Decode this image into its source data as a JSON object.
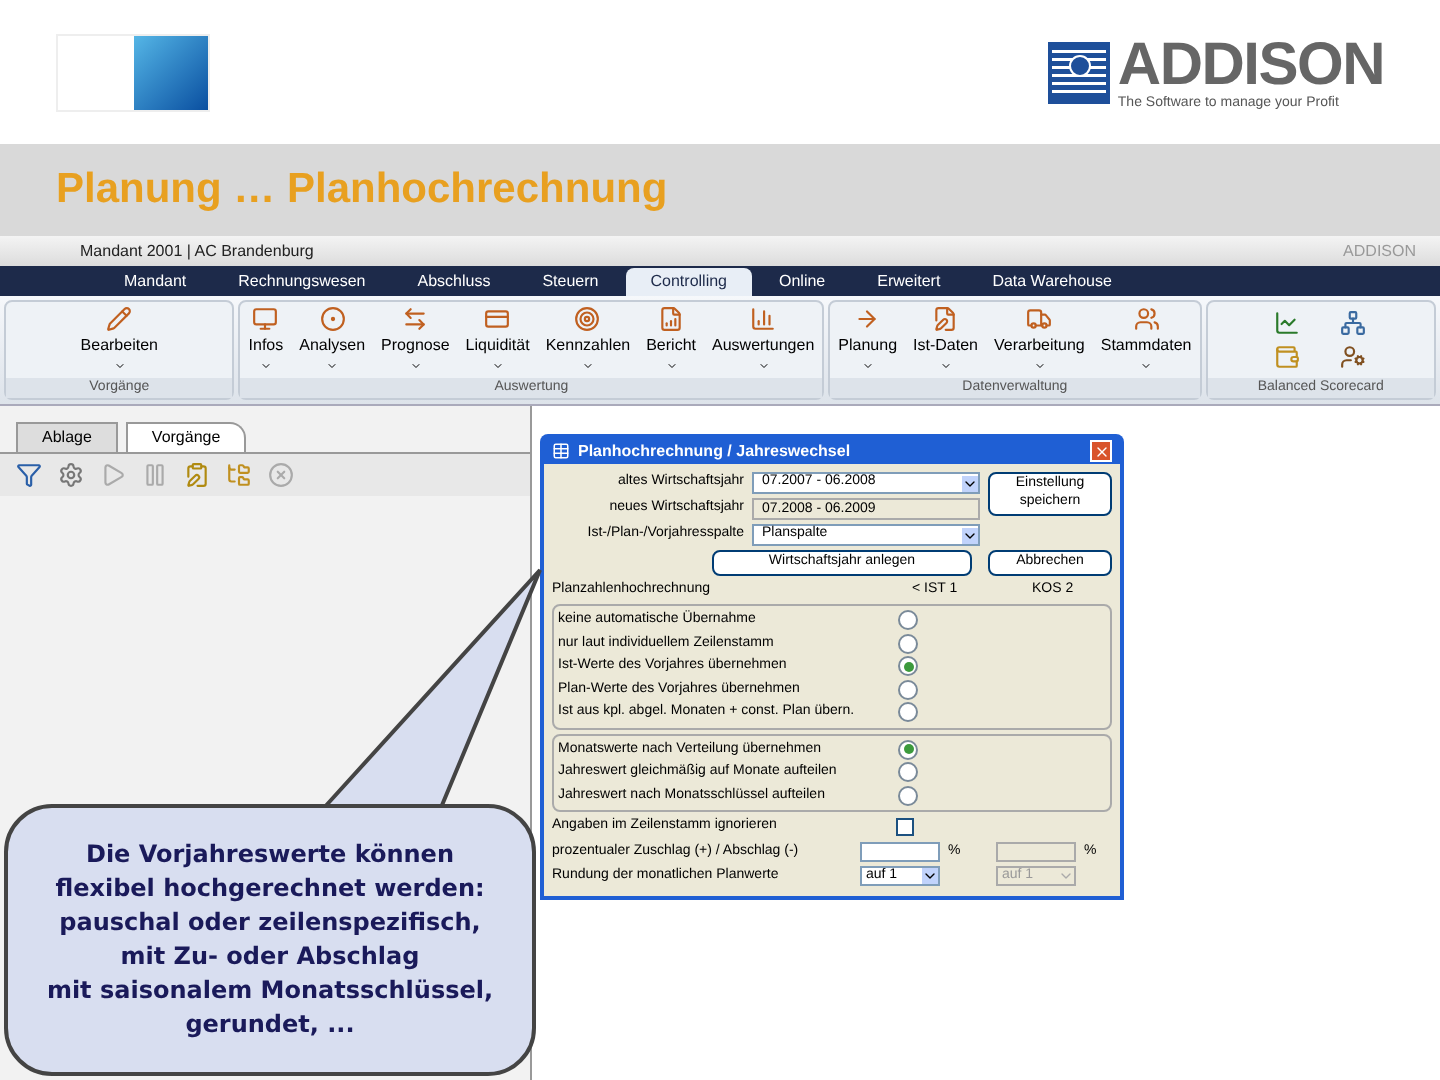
{
  "slide": {
    "title": "Planung … Planhochrechnung",
    "brand": "ADDISON",
    "tagline": "The Software to manage your Profit"
  },
  "app": {
    "title": "Mandant 2001 | AC Brandenburg",
    "brand": "ADDISON",
    "tabs": [
      {
        "label": "Mandant",
        "selected": false
      },
      {
        "label": "Rechnungswesen",
        "selected": false
      },
      {
        "label": "Abschluss",
        "selected": false
      },
      {
        "label": "Steuern",
        "selected": false
      },
      {
        "label": "Controlling",
        "selected": true
      },
      {
        "label": "Online",
        "selected": false
      },
      {
        "label": "Erweitert",
        "selected": false
      },
      {
        "label": "Data Warehouse",
        "selected": false
      }
    ],
    "ribbon_groups": [
      {
        "label": "Vorgänge",
        "items": [
          "Bearbeiten"
        ]
      },
      {
        "label": "Auswertung",
        "items": [
          "Infos",
          "Analysen",
          "Prognose",
          "Liquidität",
          "Kennzahlen",
          "Bericht",
          "Auswertungen"
        ]
      },
      {
        "label": "Datenverwaltung",
        "items": [
          "Planung",
          "Ist-Daten",
          "Verarbeitung",
          "Stammdaten"
        ]
      },
      {
        "label": "Balanced Scorecard"
      }
    ],
    "pane_tabs": [
      {
        "label": "Ablage",
        "selected": false
      },
      {
        "label": "Vorgänge",
        "selected": true
      }
    ]
  },
  "dialog": {
    "title": "Planhochrechnung / Jahreswechsel",
    "fields": [
      {
        "label": "altes Wirtschaftsjahr",
        "value": "07.2007 - 06.2008",
        "kind": "select"
      },
      {
        "label": "neues Wirtschaftsjahr",
        "value": "07.2008 - 06.2009",
        "kind": "text"
      },
      {
        "label": "Ist-/Plan-/Vorjahresspalte",
        "value": "Planspalte",
        "kind": "select"
      }
    ],
    "save_button": "Einstellung speichern",
    "create_button": "Wirtschaftsjahr anlegen",
    "cancel_button": "Abbrechen",
    "group_title": "Planzahlenhochrechnung",
    "column_1": "< IST 1",
    "column_2": "KOS 2",
    "options_1": [
      {
        "label": "keine automatische Übernahme",
        "selected": false
      },
      {
        "label": "nur laut individuellem Zeilenstamm",
        "selected": false
      },
      {
        "label": "Ist-Werte des Vorjahres übernehmen",
        "selected": true
      },
      {
        "label": "Plan-Werte des Vorjahres übernehmen",
        "selected": false
      },
      {
        "label": "Ist aus kpl. abgel. Monaten + const. Plan übern.",
        "selected": false
      }
    ],
    "options_2": [
      {
        "label": "Monatswerte nach Verteilung übernehmen",
        "selected": true
      },
      {
        "label": "Jahreswert gleichmäßig auf Monate aufteilen",
        "selected": false
      },
      {
        "label": "Jahreswert nach Monatsschlüssel aufteilen",
        "selected": false
      }
    ],
    "ignore": {
      "label": "Angaben im Zeilenstamm ignorieren",
      "checked": false
    },
    "percent": {
      "label": "prozentualer Zuschlag (+) / Abschlag (-)",
      "unit_1": "%",
      "unit_2": "%"
    },
    "rounding": {
      "label": "Rundung der monatlichen Planwerte",
      "value_1": "auf 1",
      "value_2": "auf 1"
    }
  },
  "callout": {
    "lines": [
      "Die Vorjahreswerte können",
      "flexibel hochgerechnet werden:",
      "pauschal oder zeilenspezifisch,",
      "mit Zu- oder Abschlag",
      "mit saisonalem Monatsschlüssel,",
      "gerundet, ..."
    ]
  }
}
